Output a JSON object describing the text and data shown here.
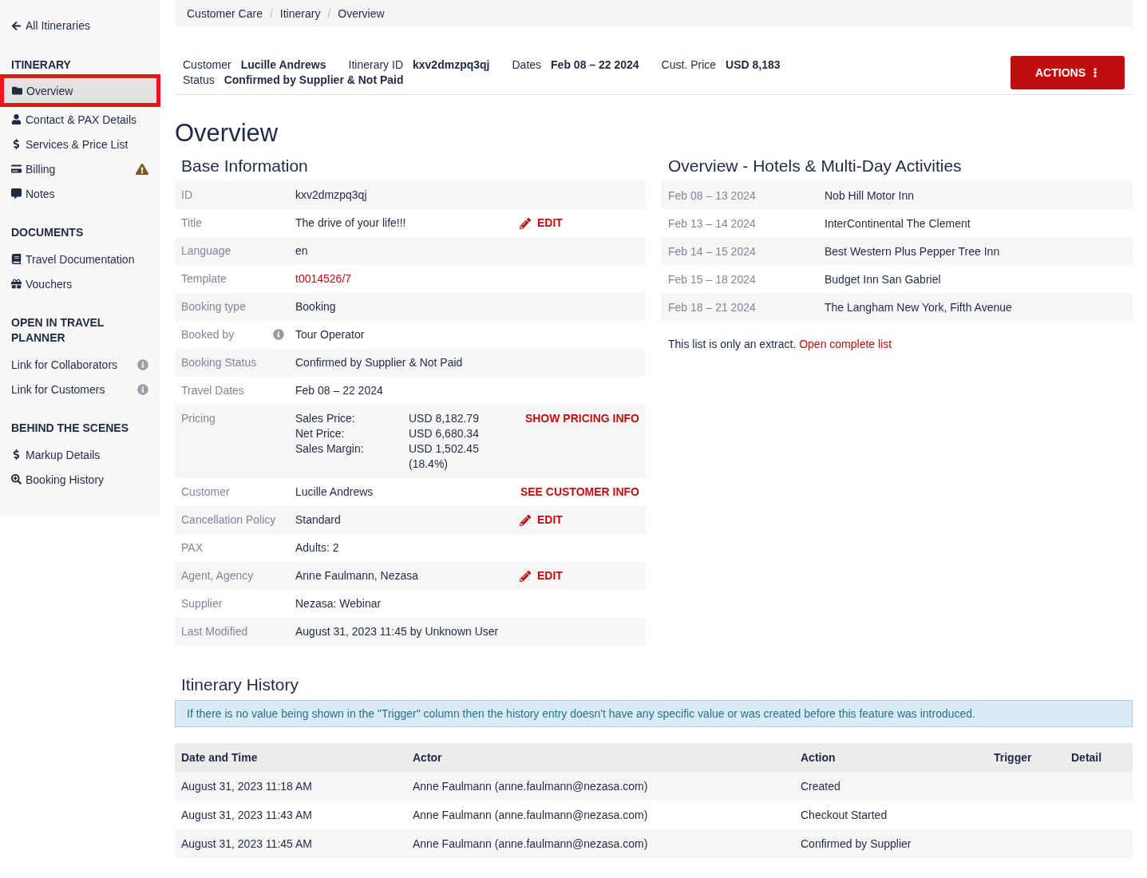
{
  "sidebar": {
    "back_link": "All Itineraries",
    "sections": [
      {
        "title": "ITINERARY",
        "items": [
          {
            "label": "Overview",
            "selected": true
          },
          {
            "label": "Contact & PAX Details",
            "selected": false
          },
          {
            "label": "Services & Price List",
            "selected": false
          },
          {
            "label": "Billing",
            "selected": false,
            "warning": true
          },
          {
            "label": "Notes",
            "selected": false
          }
        ]
      },
      {
        "title": "DOCUMENTS",
        "items": [
          {
            "label": "Travel Documentation",
            "selected": false
          },
          {
            "label": "Vouchers",
            "selected": false
          }
        ]
      },
      {
        "title": "OPEN IN TRAVEL PLANNER",
        "items": [
          {
            "label": "Link for Collaborators",
            "selected": false,
            "info": true
          },
          {
            "label": "Link for Customers",
            "selected": false,
            "info": true
          }
        ]
      },
      {
        "title": "BEHIND THE SCENES",
        "items": [
          {
            "label": "Markup Details",
            "selected": false
          },
          {
            "label": "Booking History",
            "selected": false
          }
        ]
      }
    ]
  },
  "breadcrumbs": [
    "Customer Care",
    "Itinerary",
    "Overview"
  ],
  "breadcrumb_separator": "/",
  "summary": {
    "fields": [
      {
        "label": "Customer",
        "value": "Lucille Andrews"
      },
      {
        "label": "Itinerary ID",
        "value": "kxv2dmzpq3qj"
      },
      {
        "label": "Dates",
        "value": "Feb 08 – 22 2024"
      },
      {
        "label": "Cust. Price",
        "value": "USD 8,183"
      }
    ],
    "status": {
      "label": "Status",
      "value": "Confirmed by Supplier & Not Paid"
    },
    "actions_button": "ACTIONS"
  },
  "page_title": "Overview",
  "base_info": {
    "title": "Base Information",
    "rows": [
      {
        "label": "ID",
        "value": "kxv2dmzpq3qj"
      },
      {
        "label": "Title",
        "value": "The drive of your life!!!",
        "action": {
          "kind": "edit",
          "label": "EDIT"
        }
      },
      {
        "label": "Language",
        "value": "en"
      },
      {
        "label": "Template",
        "value": "t0014526/7",
        "kind": "link"
      },
      {
        "label": "Booking type",
        "value": "Booking"
      },
      {
        "label": "Booked by",
        "value": "Tour Operator",
        "info": true
      },
      {
        "label": "Booking Status",
        "value": "Confirmed by Supplier & Not Paid"
      },
      {
        "label": "Travel Dates",
        "value": "Feb 08 – 22 2024"
      },
      {
        "label": "Pricing",
        "kind": "pricing",
        "lines": [
          {
            "label": "Sales Price:",
            "value": "USD 8,182.79"
          },
          {
            "label": "Net Price:",
            "value": "USD 6,680.34"
          },
          {
            "label": "Sales Margin:",
            "value": "USD 1,502.45 (18.4%)"
          }
        ],
        "action": {
          "kind": "link",
          "label": "SHOW PRICING INFO"
        }
      },
      {
        "label": "Customer",
        "value": "Lucille Andrews",
        "action": {
          "kind": "link",
          "label": "SEE CUSTOMER INFO"
        }
      },
      {
        "label": "Cancellation Policy",
        "value": "Standard",
        "action": {
          "kind": "edit",
          "label": "EDIT"
        }
      },
      {
        "label": "PAX",
        "value": "Adults: 2"
      },
      {
        "label": "Agent, Agency",
        "value": "Anne Faulmann, Nezasa",
        "action": {
          "kind": "edit",
          "label": "EDIT"
        }
      },
      {
        "label": "Supplier",
        "value": "Nezasa: Webinar"
      },
      {
        "label": "Last Modified",
        "value": "August 31, 2023 11:45 by Unknown User"
      }
    ]
  },
  "hotels": {
    "title": "Overview - Hotels & Multi-Day Activities",
    "rows": [
      {
        "dates": "Feb 08 – 13 2024",
        "name": "Nob Hill Motor Inn"
      },
      {
        "dates": "Feb 13 – 14 2024",
        "name": "InterContinental The Clement"
      },
      {
        "dates": "Feb 14 – 15 2024",
        "name": "Best Western Plus Pepper Tree Inn"
      },
      {
        "dates": "Feb 15 – 18 2024",
        "name": "Budget Inn San Gabriel"
      },
      {
        "dates": "Feb 18 – 21 2024",
        "name": "The Langham New York, Fifth Avenue"
      }
    ],
    "note": "This list is only an extract.",
    "note_link": "Open complete list"
  },
  "history": {
    "title": "Itinerary History",
    "notice": "If there is no value being shown in the \"Trigger\" column then the history entry doesn't have any specific value or was created before this feature was introduced.",
    "columns": [
      "Date and Time",
      "Actor",
      "Action",
      "Trigger",
      "Detail"
    ],
    "rows": [
      [
        "August 31, 2023 11:18 AM",
        "Anne Faulmann (anne.faulmann@nezasa.com)",
        "Created"
      ],
      [
        "August 31, 2023 11:43 AM",
        "Anne Faulmann (anne.faulmann@nezasa.com)",
        "Checkout Started"
      ],
      [
        "August 31, 2023 11:45 AM",
        "Anne Faulmann (anne.faulmann@nezasa.com)",
        "Confirmed by Supplier"
      ]
    ]
  }
}
